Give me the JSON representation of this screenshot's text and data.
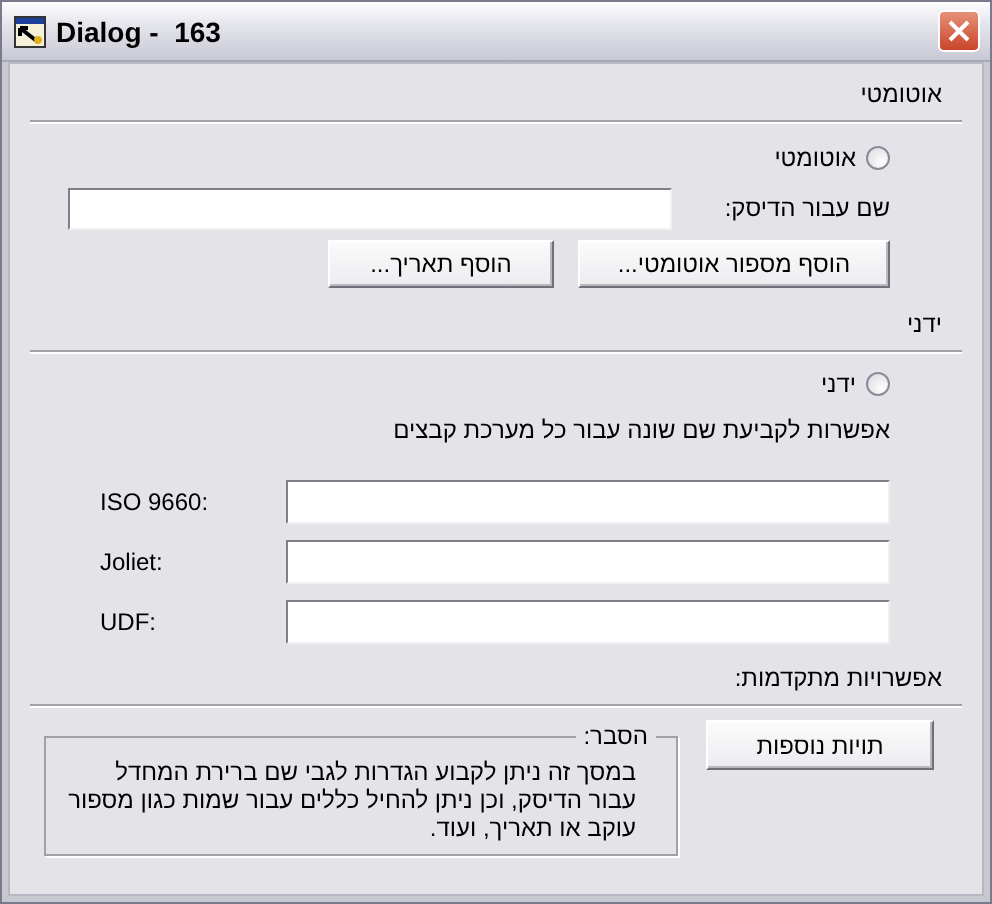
{
  "window": {
    "title": "Dialog -  163"
  },
  "automatic": {
    "heading": "אוטומטי",
    "radio": {
      "label": "אוטומטי",
      "selected": false
    },
    "disc_name": {
      "label": "שם עבור הדיסק:"
    },
    "buttons": [
      "הוסף מספור אוטומטי...",
      "הוסף תאריך..."
    ]
  },
  "manual": {
    "heading": "ידני",
    "radio": {
      "label": "ידני",
      "selected": false
    },
    "description": "אפשרות לקביעת שם שונה עבור כל מערכת קבצים",
    "fields": [
      {
        "label": "ISO 9660:"
      },
      {
        "label": "Joliet:"
      },
      {
        "label": "UDF:"
      }
    ]
  },
  "advanced": {
    "heading": "אפשרויות מתקדמות:",
    "button": "תויות נוספות",
    "explanation": {
      "title": "הסבר:",
      "text": "במסך זה ניתן לקבוע הגדרות לגבי שם ברירת המחדל עבור הדיסק, וכן ניתן להחיל כללים עבור שמות כגון מספור עוקב או תאריך, ועוד."
    }
  }
}
